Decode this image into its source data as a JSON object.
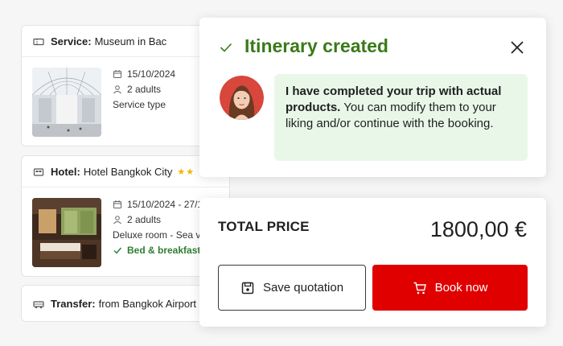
{
  "service": {
    "head_label": "Service:",
    "head_value": "Museum in Bac",
    "date": "15/10/2024",
    "adults": "2 adults",
    "type": "Service type"
  },
  "hotel": {
    "head_label": "Hotel:",
    "head_value": "Hotel Bangkok City",
    "stars": "★★",
    "date": "15/10/2024 - 27/1",
    "adults": "2 adults",
    "room": "Deluxe room - Sea vie",
    "board": "Bed & breakfast"
  },
  "transfer": {
    "head_label": "Transfer:",
    "head_value": "from Bangkok Airport"
  },
  "popup": {
    "title": "Itinerary created",
    "message_bold": "I have completed your trip with actual products.",
    "message_rest": " You can modify them to your liking and/or continue with the booking."
  },
  "price": {
    "label": "TOTAL PRICE",
    "amount": "1800,00 €",
    "save_label": "Save quotation",
    "book_label": "Book now"
  },
  "colors": {
    "accent_green": "#3a7a19",
    "book_red": "#e00000",
    "bubble_bg": "#e9f7e9"
  },
  "icons": [
    "ticket-icon",
    "calendar-icon",
    "person-icon",
    "bed-icon",
    "check-icon",
    "bus-icon",
    "close-icon",
    "save-icon",
    "cart-icon"
  ]
}
